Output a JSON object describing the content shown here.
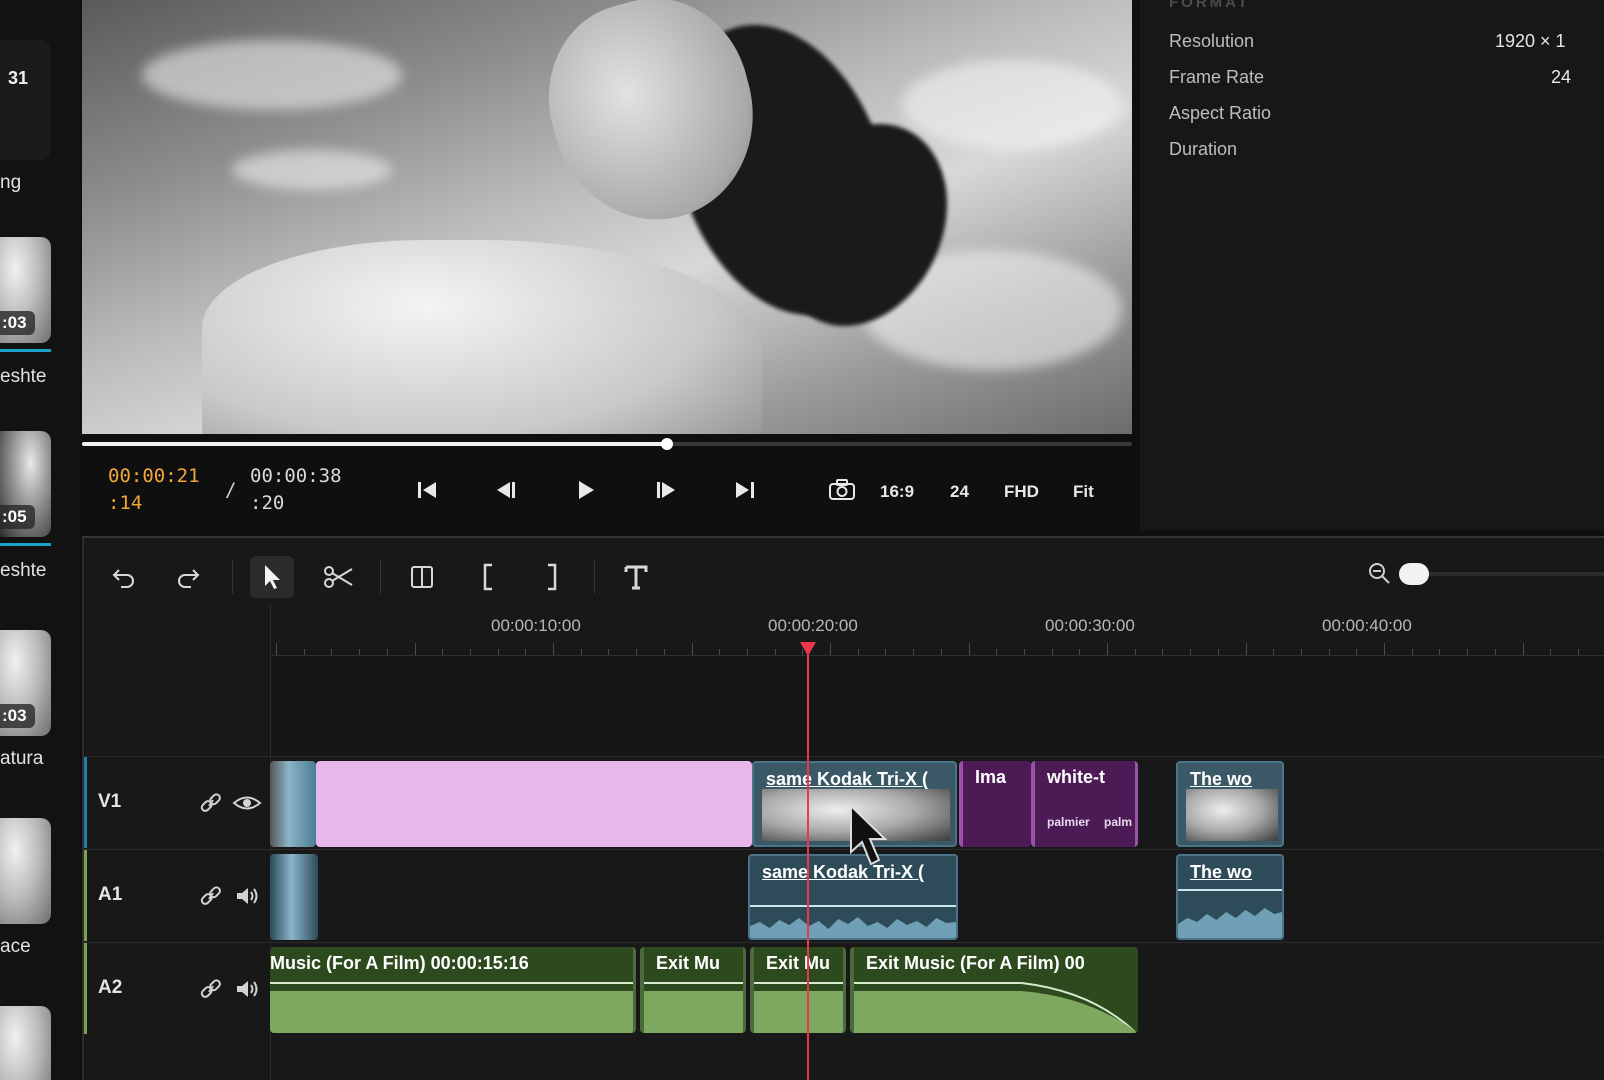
{
  "media_bin": {
    "count": "31",
    "items": [
      {
        "label": "ng"
      },
      {
        "duration": ":03",
        "label": "eshte"
      },
      {
        "duration": ":05",
        "label": "eshte"
      },
      {
        "duration": ":03",
        "label": "atura"
      },
      {
        "label": "ace"
      }
    ]
  },
  "player": {
    "current_tc": "00:00:21\n:14",
    "separator": "/",
    "total_tc": "00:00:38\n:20",
    "progress_fraction": 0.557,
    "aspect": "16:9",
    "fps": "24",
    "quality": "FHD",
    "zoom": "Fit"
  },
  "format_panel": {
    "heading": "FORMAT",
    "rows": [
      {
        "label": "Resolution",
        "value": "1920 × 1"
      },
      {
        "label": "Frame Rate",
        "value": "24"
      },
      {
        "label": "Aspect Ratio",
        "value": ""
      },
      {
        "label": "Duration",
        "value": ""
      }
    ]
  },
  "timeline": {
    "ruler_labels": [
      "00:00:10:00",
      "00:00:20:00",
      "00:00:30:00",
      "00:00:40:00"
    ],
    "tracks": {
      "v1": {
        "name": "V1"
      },
      "a1": {
        "name": "A1"
      },
      "a2": {
        "name": "A2"
      }
    },
    "clips": {
      "v1_kodak": "same Kodak Tri-X (",
      "v1_ima": "Ima",
      "v1_white": "white-t",
      "v1_palmier1": "palmier",
      "v1_palmier2": "palm",
      "v1_thewor": "The wo",
      "a1_kodak": "same Kodak Tri-X (",
      "a1_thewor": "The wo",
      "a2_music1": "Music (For A Film)  00:00:15:16",
      "a2_exit1": "Exit Mu",
      "a2_exit2": "Exit Mu",
      "a2_music2": "Exit Music (For A Film)  00"
    }
  },
  "colors": {
    "accent_timecode": "#f1a83a",
    "playhead": "#e8384a",
    "video_clip_pink": "#e7b6eb",
    "video_clip_purple": "#4c1b55",
    "audio_clip_green": "#2d4a1e",
    "linked_clip_blue": "#2d4b58"
  }
}
